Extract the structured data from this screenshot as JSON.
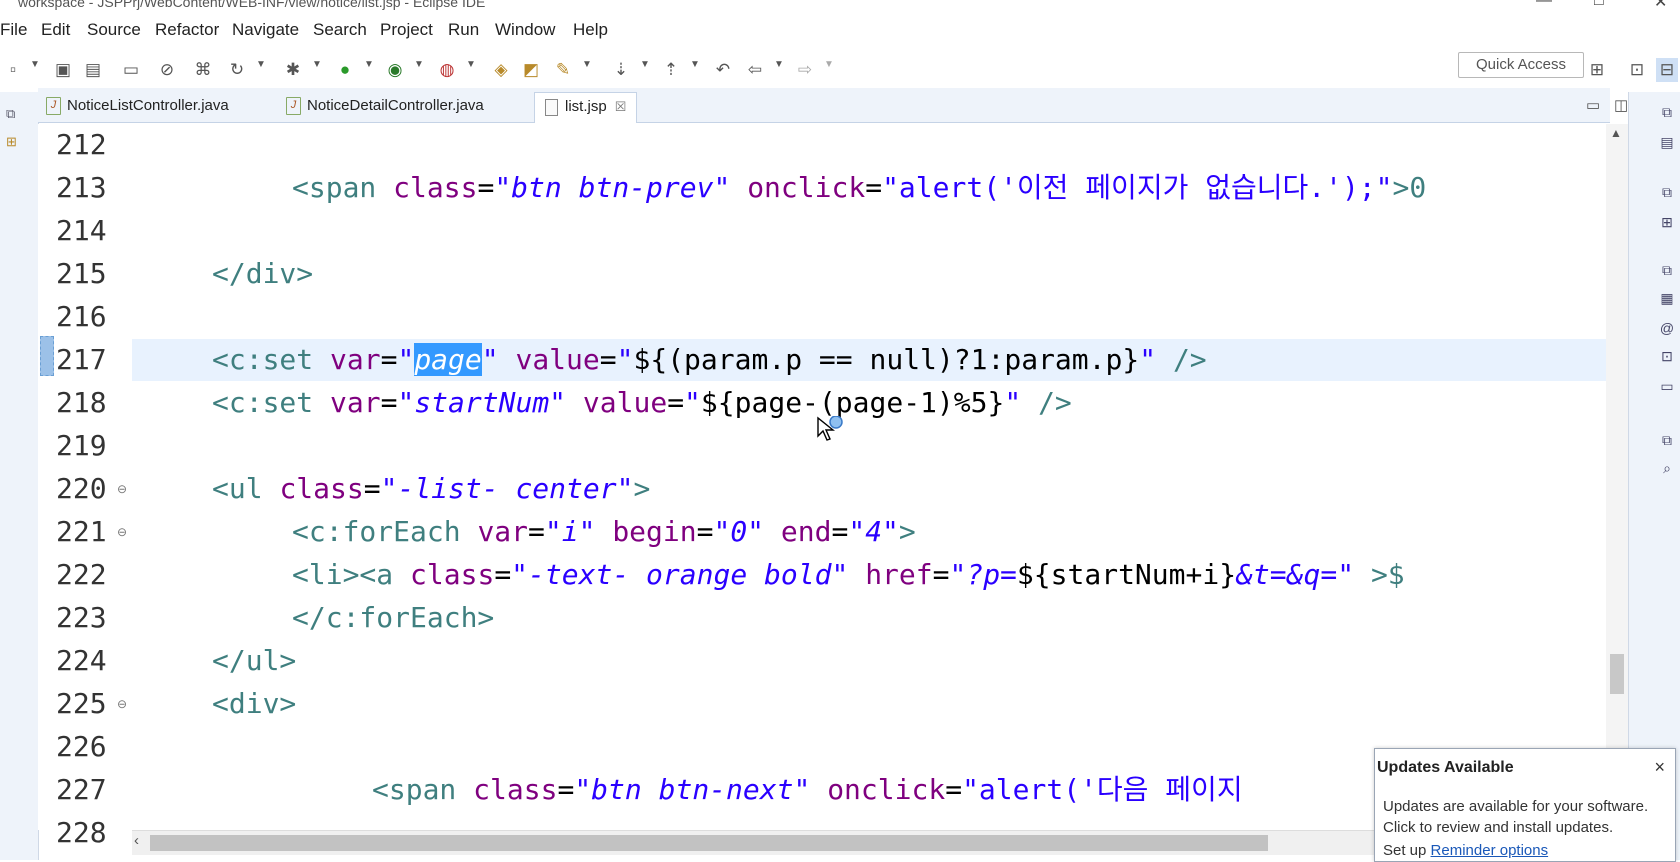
{
  "window": {
    "title": "workspace - JSPPrj/WebContent/WEB-INF/view/notice/list.jsp - Eclipse IDE"
  },
  "menu": [
    "File",
    "Edit",
    "Source",
    "Refactor",
    "Navigate",
    "Search",
    "Project",
    "Run",
    "Window",
    "Help"
  ],
  "toolbar": {
    "quick_access": "Quick Access"
  },
  "tabs": [
    {
      "label": "NoticeListController.java",
      "active": false
    },
    {
      "label": "NoticeDetailController.java",
      "active": false
    },
    {
      "label": "list.jsp",
      "active": true,
      "close": "☒"
    }
  ],
  "editor": {
    "current_line": 217,
    "selected_text": "page",
    "lines": [
      {
        "n": "212"
      },
      {
        "n": "213"
      },
      {
        "n": "214"
      },
      {
        "n": "215"
      },
      {
        "n": "216"
      },
      {
        "n": "217"
      },
      {
        "n": "218"
      },
      {
        "n": "219"
      },
      {
        "n": "220"
      },
      {
        "n": "221"
      },
      {
        "n": "222"
      },
      {
        "n": "223"
      },
      {
        "n": "224"
      },
      {
        "n": "225"
      },
      {
        "n": "226"
      },
      {
        "n": "227"
      },
      {
        "n": "228"
      }
    ]
  },
  "code": {
    "l213": {
      "open": "<span",
      "a1": "class",
      "eq1": "=",
      "v1": "\"btn btn-prev\"",
      "a2": "onclick",
      "eq2": "=",
      "v2": "\"alert('이전 페이지가 없습니다.');\"",
      "rest": ">0"
    },
    "l215": {
      "tag": "</div>"
    },
    "l217": {
      "open": "<c:set",
      "a1": "var",
      "eq1": "=",
      "q1": "\"",
      "sel": "page",
      "q2": "\"",
      "a2": "value",
      "eq2": "=",
      "v2a": "\"",
      "expr": "${(param.p == null)?1:param.p}",
      "v2b": "\"",
      "close": "/>"
    },
    "l218": {
      "open": "<c:set",
      "a1": "var",
      "eq1": "=",
      "v1": "\"startNum\"",
      "a2": "value",
      "eq2": "=",
      "v2a": "\"",
      "expr": "${page-(page-1)%5}",
      "v2b": "\"",
      "close": "/>"
    },
    "l220": {
      "open": "<ul",
      "a1": "class",
      "eq1": "=",
      "v1": "\"-list- center\"",
      "close": ">"
    },
    "l221": {
      "open": "<c:forEach",
      "a1": "var",
      "eq1": "=",
      "v1": "\"i\"",
      "a2": "begin",
      "eq2": "=",
      "v2": "\"0\"",
      "a3": "end",
      "eq3": "=",
      "v3": "\"4\"",
      "close": ">"
    },
    "l222": {
      "open": "<li><a",
      "a1": "class",
      "eq1": "=",
      "v1": "\"-text- orange bold\"",
      "a2": "href",
      "eq2": "=",
      "v2a": "\"?p=",
      "expr": "${startNum+i}",
      "v2b": "&t=&q=\"",
      "rest": ">$"
    },
    "l223": {
      "tag": "</c:forEach>"
    },
    "l224": {
      "tag": "</ul>"
    },
    "l225": {
      "tag": "<div>"
    },
    "l227": {
      "open": "<span",
      "a1": "class",
      "eq1": "=",
      "v1": "\"btn btn-next\"",
      "a2": "onclick",
      "eq2": "=",
      "v2": "\"alert('다음 페이지"
    }
  },
  "notification": {
    "title": "Updates Available",
    "close": "×",
    "body": "Updates are available for your software. Click to review and install updates.",
    "setup": "Set up",
    "link": "Reminder options"
  },
  "colors": {
    "tag": "#3f7f7f",
    "attribute": "#7f007f",
    "string": "#2a00ff",
    "selection": "#3399ff",
    "current_line": "#e8f2fe"
  }
}
